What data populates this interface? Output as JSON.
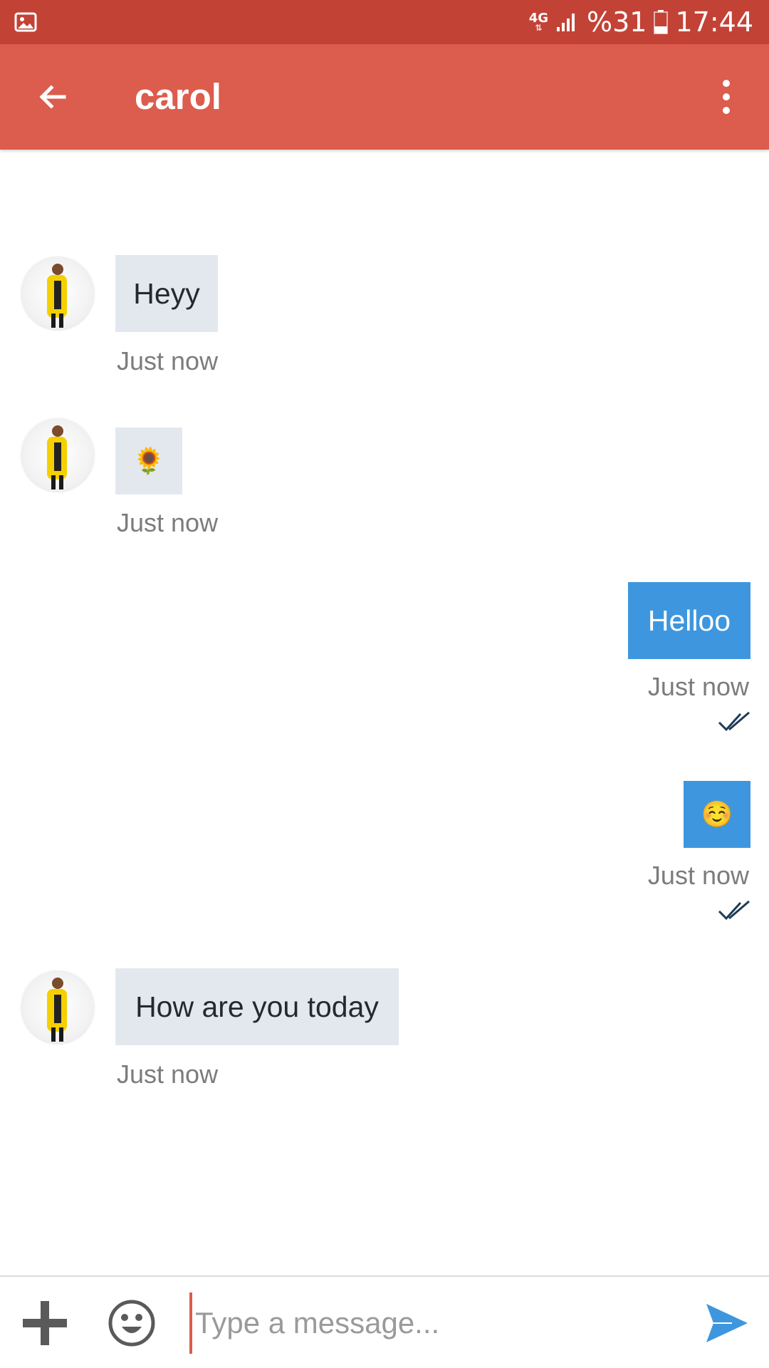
{
  "status_bar": {
    "network": "4G",
    "battery": "%31",
    "time": "17:44"
  },
  "header": {
    "title": "carol"
  },
  "messages": [
    {
      "direction": "in",
      "text": "Heyy",
      "time": "Just now"
    },
    {
      "direction": "in",
      "text": "🌻",
      "time": "Just now"
    },
    {
      "direction": "out",
      "text": "Helloo",
      "time": "Just now"
    },
    {
      "direction": "out",
      "text": "☺️",
      "time": "Just now"
    },
    {
      "direction": "in",
      "text": "How are you today",
      "time": "Just now"
    }
  ],
  "composer": {
    "placeholder": "Type a message..."
  },
  "colors": {
    "status_bar": "#c34236",
    "app_bar": "#dc5c4d",
    "incoming_bubble": "#e3e8ee",
    "outgoing_bubble": "#3e97de"
  }
}
